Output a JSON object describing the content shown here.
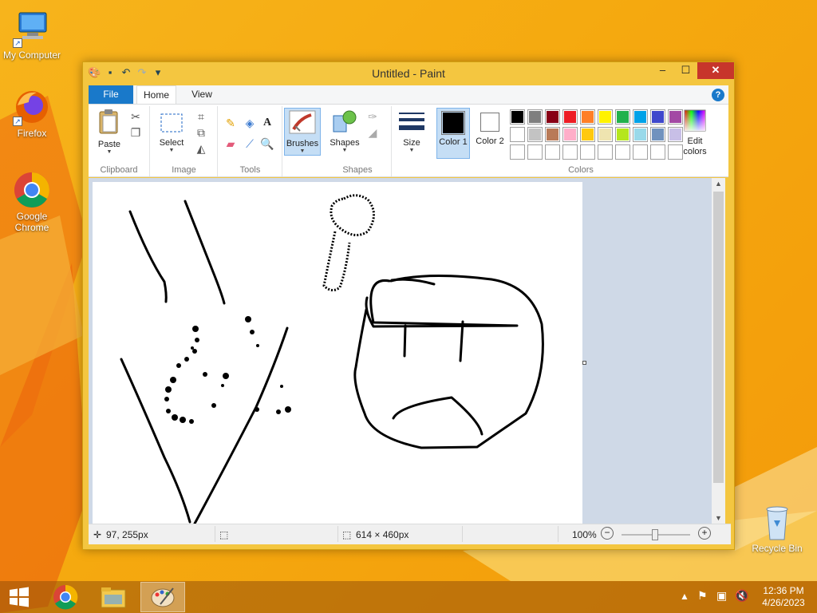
{
  "desktop": {
    "icons": [
      {
        "label": "My Computer"
      },
      {
        "label": "Firefox"
      },
      {
        "label": "Google Chrome"
      },
      {
        "label": "Recycle Bin"
      }
    ]
  },
  "window": {
    "title": "Untitled - Paint",
    "controls": {
      "minimize": "–",
      "maximize": "☐",
      "close": "✕"
    }
  },
  "ribbon": {
    "tabs": [
      {
        "label": "File"
      },
      {
        "label": "Home"
      },
      {
        "label": "View"
      }
    ],
    "help_label": "?",
    "groups": {
      "clipboard": {
        "label": "Clipboard",
        "paste": "Paste"
      },
      "image": {
        "label": "Image",
        "select": "Select"
      },
      "tools": {
        "label": "Tools",
        "text_glyph": "A"
      },
      "brushes": {
        "label": "Brushes"
      },
      "shapes": {
        "label": "Shapes",
        "button": "Shapes"
      },
      "size": {
        "label": "Size"
      },
      "colors": {
        "label": "Colors",
        "color1": "Color 1",
        "color1_line2": "1",
        "color2": "Color 2",
        "color2_line2": "2",
        "edit": "Edit colors",
        "color1_value": "#000000",
        "color2_value": "#ffffff",
        "palette_row1": [
          "#000000",
          "#7f7f7f",
          "#880015",
          "#ed1c24",
          "#ff7f27",
          "#fff200",
          "#22b14c",
          "#00a2e8",
          "#3f48cc",
          "#a349a4"
        ],
        "palette_row2": [
          "#ffffff",
          "#c3c3c3",
          "#b97a57",
          "#ffaec9",
          "#ffc90e",
          "#efe4b0",
          "#b5e61d",
          "#99d9ea",
          "#7092be",
          "#c8bfe7"
        ],
        "palette_row3": [
          "#ffffff",
          "#ffffff",
          "#ffffff",
          "#ffffff",
          "#ffffff",
          "#ffffff",
          "#ffffff",
          "#ffffff",
          "#ffffff",
          "#ffffff"
        ]
      }
    }
  },
  "status": {
    "cursor_pos": "97, 255px",
    "canvas_size": "614 × 460px",
    "zoom": "100%"
  },
  "taskbar": {
    "clock_time": "12:36 PM",
    "clock_date": "4/26/2023"
  }
}
